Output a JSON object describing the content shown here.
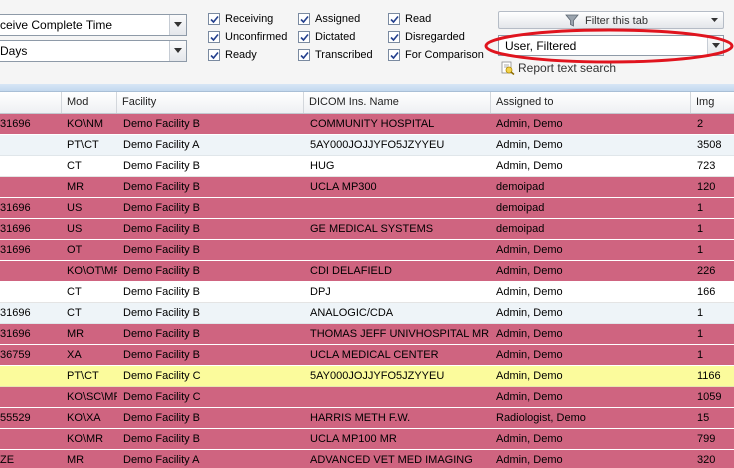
{
  "filters": {
    "date_field": "ceive Complete Time",
    "date_range": "Days",
    "checkboxes": [
      {
        "label": "Receiving",
        "checked": true
      },
      {
        "label": "Unconfirmed",
        "checked": true
      },
      {
        "label": "Ready",
        "checked": true
      },
      {
        "label": "Assigned",
        "checked": true
      },
      {
        "label": "Dictated",
        "checked": true
      },
      {
        "label": "Transcribed",
        "checked": true
      },
      {
        "label": "Read",
        "checked": true
      },
      {
        "label": "Disregarded",
        "checked": true
      },
      {
        "label": "For Comparison",
        "checked": true
      }
    ],
    "filter_tab_label": "Filter this tab",
    "user_filter": "User, Filtered",
    "report_search_label": "Report text search",
    "highlight_color": "#e0141e"
  },
  "table": {
    "columns": [
      "",
      "Mod",
      "Facility",
      "DICOM Ins. Name",
      "Assigned to",
      "Img"
    ],
    "rows": [
      {
        "style": "pink",
        "cells": [
          "31696",
          "KO\\NM",
          "Demo Facility B",
          "COMMUNITY HOSPITAL",
          "Admin, Demo",
          "2"
        ]
      },
      {
        "style": "lightblue",
        "cells": [
          "",
          "PT\\CT",
          "Demo Facility A",
          "5AY000JOJJYFO5JZYYEU",
          "Admin, Demo",
          "3508"
        ]
      },
      {
        "style": "white",
        "cells": [
          "",
          "CT",
          "Demo Facility B",
          "HUG",
          "Admin, Demo",
          "723"
        ]
      },
      {
        "style": "pink",
        "cells": [
          "",
          "MR",
          "Demo Facility B",
          "UCLA MP300",
          "demoipad",
          "120"
        ]
      },
      {
        "style": "pink",
        "cells": [
          "31696",
          "US",
          "Demo Facility B",
          "",
          "demoipad",
          "1"
        ]
      },
      {
        "style": "pink",
        "cells": [
          "31696",
          "US",
          "Demo Facility B",
          "GE MEDICAL SYSTEMS",
          "demoipad",
          "1"
        ]
      },
      {
        "style": "pink",
        "cells": [
          "31696",
          "OT",
          "Demo Facility B",
          "",
          "Admin, Demo",
          "1"
        ]
      },
      {
        "style": "pink",
        "cells": [
          "",
          "KO\\OT\\MR",
          "Demo Facility B",
          "CDI DELAFIELD",
          "Admin, Demo",
          "226"
        ]
      },
      {
        "style": "white",
        "cells": [
          "",
          "CT",
          "Demo Facility B",
          "DPJ",
          "Admin, Demo",
          "166"
        ]
      },
      {
        "style": "lightblue",
        "cells": [
          "31696",
          "CT",
          "Demo Facility B",
          "ANALOGIC/CDA",
          "Admin, Demo",
          "1"
        ]
      },
      {
        "style": "pink",
        "cells": [
          "31696",
          "MR",
          "Demo Facility B",
          "THOMAS JEFF UNIVHOSPITAL MRI",
          "Admin, Demo",
          "1"
        ]
      },
      {
        "style": "pink",
        "cells": [
          "36759",
          "XA",
          "Demo Facility B",
          "UCLA MEDICAL CENTER",
          "Admin, Demo",
          "1"
        ]
      },
      {
        "style": "yellow",
        "cells": [
          "",
          "PT\\CT",
          "Demo Facility C",
          "5AY000JOJJYFO5JZYYEU",
          "Admin, Demo",
          "1166"
        ]
      },
      {
        "style": "pink",
        "cells": [
          "",
          "KO\\SC\\MR",
          "Demo Facility C",
          "",
          "Admin, Demo",
          "1059"
        ]
      },
      {
        "style": "pink",
        "cells": [
          "55529",
          "KO\\XA",
          "Demo Facility B",
          "HARRIS METH F.W.",
          "Radiologist, Demo",
          "15"
        ]
      },
      {
        "style": "pink",
        "cells": [
          "",
          "KO\\MR",
          "Demo Facility B",
          "UCLA MP100 MR",
          "Admin, Demo",
          "799"
        ]
      },
      {
        "style": "pink",
        "cells": [
          "ZE",
          "MR",
          "Demo Facility A",
          "ADVANCED VET MED IMAGING",
          "Admin, Demo",
          "320"
        ]
      }
    ]
  }
}
